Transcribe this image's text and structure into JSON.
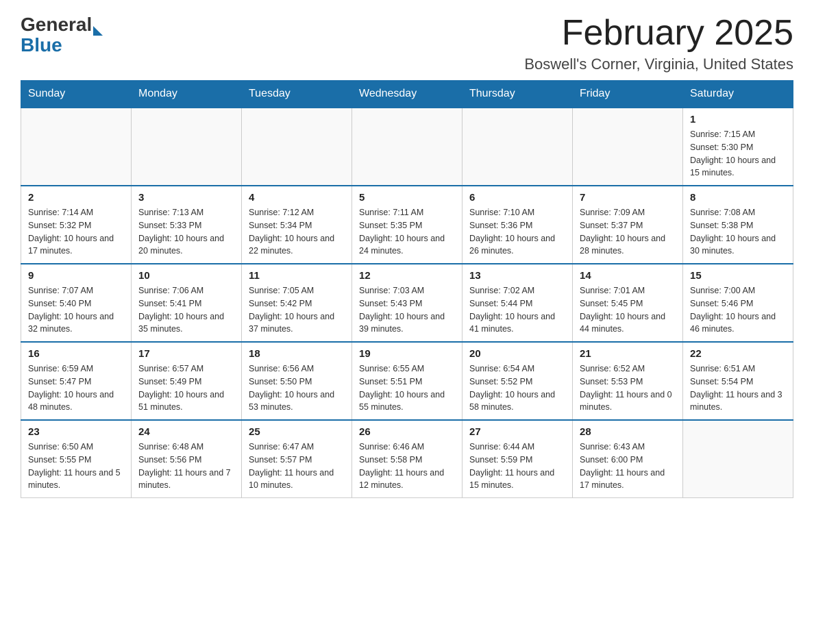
{
  "logo": {
    "general": "General",
    "blue": "Blue",
    "arrow_color": "#1a6ea8"
  },
  "title": {
    "month": "February 2025",
    "location": "Boswell's Corner, Virginia, United States"
  },
  "header_days": [
    "Sunday",
    "Monday",
    "Tuesday",
    "Wednesday",
    "Thursday",
    "Friday",
    "Saturday"
  ],
  "weeks": [
    {
      "days": [
        {
          "number": "",
          "info": ""
        },
        {
          "number": "",
          "info": ""
        },
        {
          "number": "",
          "info": ""
        },
        {
          "number": "",
          "info": ""
        },
        {
          "number": "",
          "info": ""
        },
        {
          "number": "",
          "info": ""
        },
        {
          "number": "1",
          "info": "Sunrise: 7:15 AM\nSunset: 5:30 PM\nDaylight: 10 hours and 15 minutes."
        }
      ]
    },
    {
      "days": [
        {
          "number": "2",
          "info": "Sunrise: 7:14 AM\nSunset: 5:32 PM\nDaylight: 10 hours and 17 minutes."
        },
        {
          "number": "3",
          "info": "Sunrise: 7:13 AM\nSunset: 5:33 PM\nDaylight: 10 hours and 20 minutes."
        },
        {
          "number": "4",
          "info": "Sunrise: 7:12 AM\nSunset: 5:34 PM\nDaylight: 10 hours and 22 minutes."
        },
        {
          "number": "5",
          "info": "Sunrise: 7:11 AM\nSunset: 5:35 PM\nDaylight: 10 hours and 24 minutes."
        },
        {
          "number": "6",
          "info": "Sunrise: 7:10 AM\nSunset: 5:36 PM\nDaylight: 10 hours and 26 minutes."
        },
        {
          "number": "7",
          "info": "Sunrise: 7:09 AM\nSunset: 5:37 PM\nDaylight: 10 hours and 28 minutes."
        },
        {
          "number": "8",
          "info": "Sunrise: 7:08 AM\nSunset: 5:38 PM\nDaylight: 10 hours and 30 minutes."
        }
      ]
    },
    {
      "days": [
        {
          "number": "9",
          "info": "Sunrise: 7:07 AM\nSunset: 5:40 PM\nDaylight: 10 hours and 32 minutes."
        },
        {
          "number": "10",
          "info": "Sunrise: 7:06 AM\nSunset: 5:41 PM\nDaylight: 10 hours and 35 minutes."
        },
        {
          "number": "11",
          "info": "Sunrise: 7:05 AM\nSunset: 5:42 PM\nDaylight: 10 hours and 37 minutes."
        },
        {
          "number": "12",
          "info": "Sunrise: 7:03 AM\nSunset: 5:43 PM\nDaylight: 10 hours and 39 minutes."
        },
        {
          "number": "13",
          "info": "Sunrise: 7:02 AM\nSunset: 5:44 PM\nDaylight: 10 hours and 41 minutes."
        },
        {
          "number": "14",
          "info": "Sunrise: 7:01 AM\nSunset: 5:45 PM\nDaylight: 10 hours and 44 minutes."
        },
        {
          "number": "15",
          "info": "Sunrise: 7:00 AM\nSunset: 5:46 PM\nDaylight: 10 hours and 46 minutes."
        }
      ]
    },
    {
      "days": [
        {
          "number": "16",
          "info": "Sunrise: 6:59 AM\nSunset: 5:47 PM\nDaylight: 10 hours and 48 minutes."
        },
        {
          "number": "17",
          "info": "Sunrise: 6:57 AM\nSunset: 5:49 PM\nDaylight: 10 hours and 51 minutes."
        },
        {
          "number": "18",
          "info": "Sunrise: 6:56 AM\nSunset: 5:50 PM\nDaylight: 10 hours and 53 minutes."
        },
        {
          "number": "19",
          "info": "Sunrise: 6:55 AM\nSunset: 5:51 PM\nDaylight: 10 hours and 55 minutes."
        },
        {
          "number": "20",
          "info": "Sunrise: 6:54 AM\nSunset: 5:52 PM\nDaylight: 10 hours and 58 minutes."
        },
        {
          "number": "21",
          "info": "Sunrise: 6:52 AM\nSunset: 5:53 PM\nDaylight: 11 hours and 0 minutes."
        },
        {
          "number": "22",
          "info": "Sunrise: 6:51 AM\nSunset: 5:54 PM\nDaylight: 11 hours and 3 minutes."
        }
      ]
    },
    {
      "days": [
        {
          "number": "23",
          "info": "Sunrise: 6:50 AM\nSunset: 5:55 PM\nDaylight: 11 hours and 5 minutes."
        },
        {
          "number": "24",
          "info": "Sunrise: 6:48 AM\nSunset: 5:56 PM\nDaylight: 11 hours and 7 minutes."
        },
        {
          "number": "25",
          "info": "Sunrise: 6:47 AM\nSunset: 5:57 PM\nDaylight: 11 hours and 10 minutes."
        },
        {
          "number": "26",
          "info": "Sunrise: 6:46 AM\nSunset: 5:58 PM\nDaylight: 11 hours and 12 minutes."
        },
        {
          "number": "27",
          "info": "Sunrise: 6:44 AM\nSunset: 5:59 PM\nDaylight: 11 hours and 15 minutes."
        },
        {
          "number": "28",
          "info": "Sunrise: 6:43 AM\nSunset: 6:00 PM\nDaylight: 11 hours and 17 minutes."
        },
        {
          "number": "",
          "info": ""
        }
      ]
    }
  ]
}
